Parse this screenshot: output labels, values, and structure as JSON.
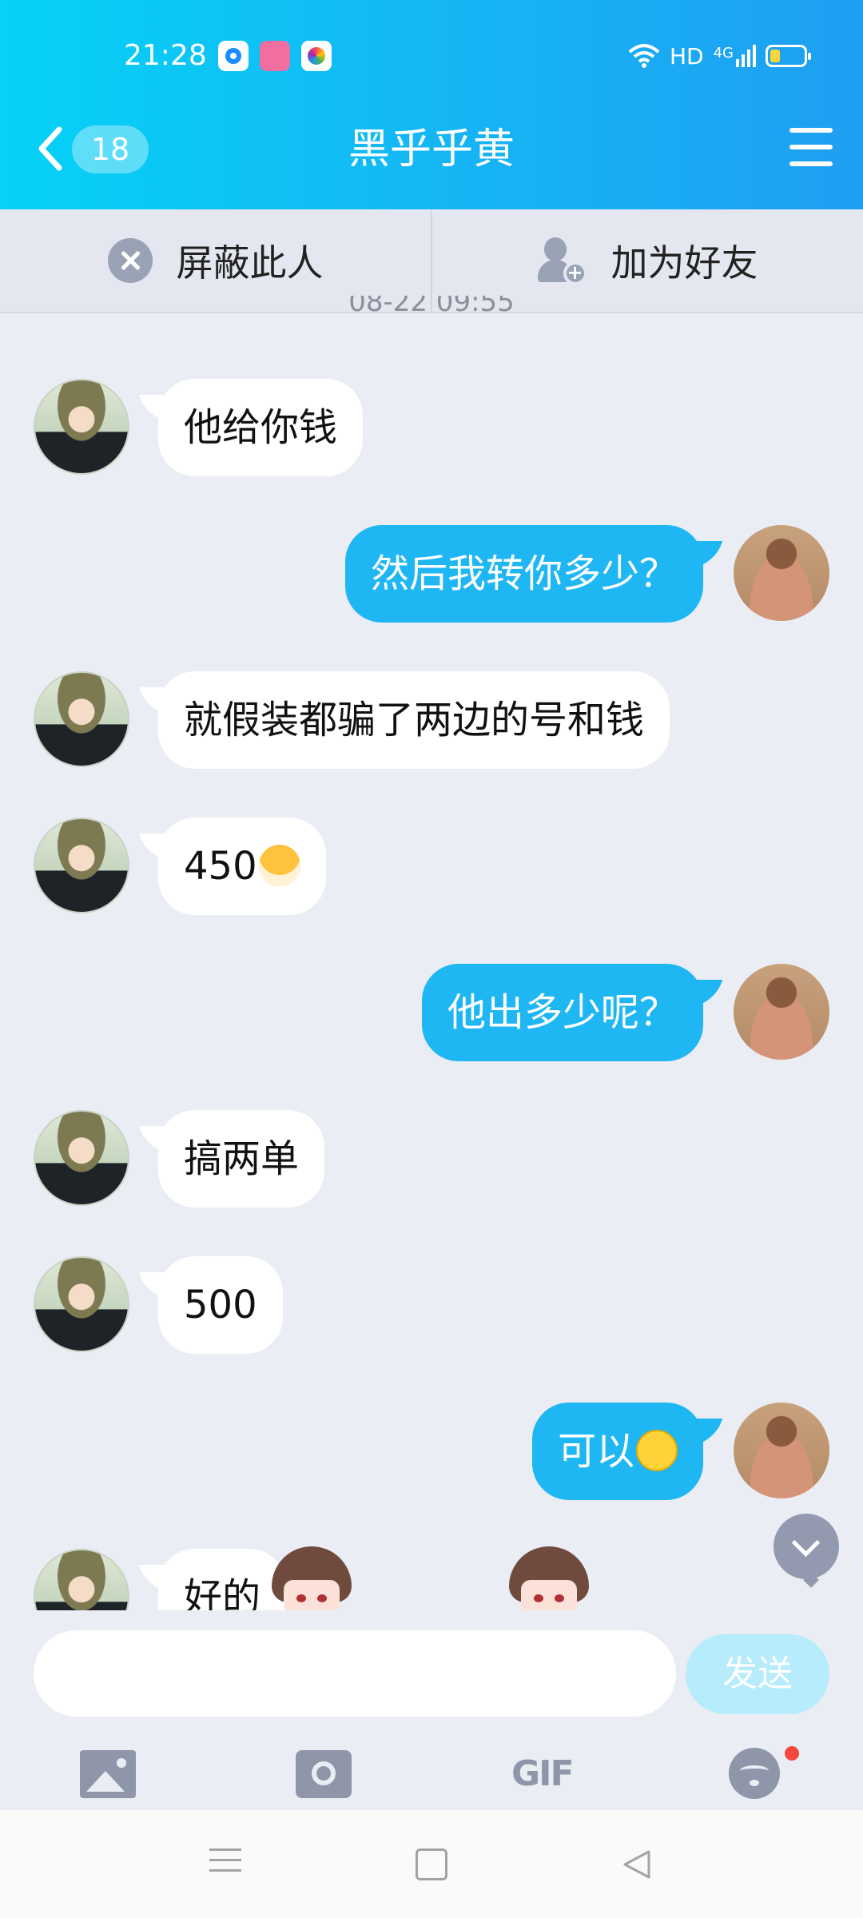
{
  "status_bar": {
    "time": "21:28",
    "network": "HD",
    "signal": "4G"
  },
  "header": {
    "unread_count": "18",
    "title": "黑乎乎黄"
  },
  "actions": {
    "block_label": "屏蔽此人",
    "add_friend_label": "加为好友"
  },
  "timestamp": "08-22 09:55",
  "messages": [
    {
      "side": "in",
      "text": "他给你钱"
    },
    {
      "side": "out",
      "text": "然后我转你多少？"
    },
    {
      "side": "in",
      "text": "就假装都骗了两边的号和钱"
    },
    {
      "side": "in",
      "text": "450",
      "emoji": "dog-face-emoji"
    },
    {
      "side": "out",
      "text": "他出多少呢？"
    },
    {
      "side": "in",
      "text": "搞两单"
    },
    {
      "side": "in",
      "text": "500"
    },
    {
      "side": "out",
      "text": "可以",
      "emoji": "smirk-emoji"
    },
    {
      "side": "in",
      "text": "好的"
    }
  ],
  "composer": {
    "input_value": "",
    "send_label": "发送"
  },
  "toolbar": {
    "gif_label": "GIF"
  },
  "colors": {
    "header_start": "#05d2f6",
    "header_end": "#1e9ff2",
    "outgoing_bubble": "#1fb6f4",
    "background": "#eaedf4",
    "send_button": "#b6ecfc"
  }
}
